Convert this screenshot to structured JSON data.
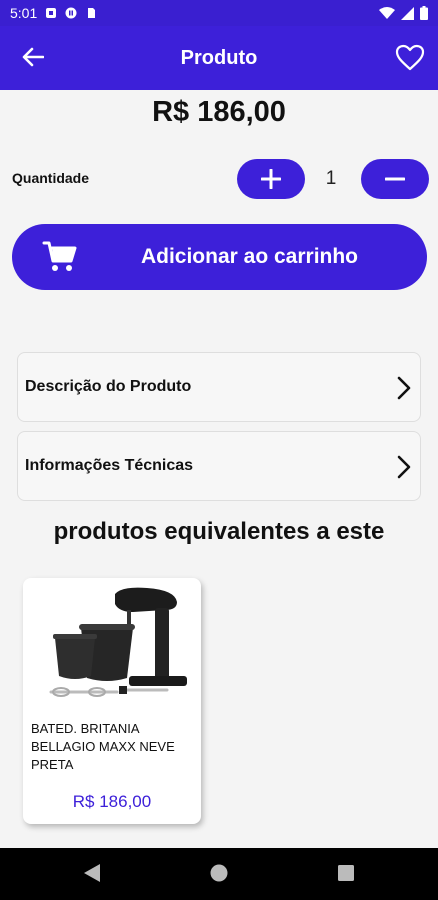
{
  "status_bar": {
    "time": "5:01",
    "left_icons": [
      "notification-square-icon",
      "pause-circle-icon",
      "sim-card-icon"
    ],
    "right_icons": [
      "wifi-icon",
      "signal-icon",
      "battery-icon"
    ]
  },
  "app_bar": {
    "title": "Produto",
    "back_icon": "arrow-left-icon",
    "favorite_icon": "heart-outline-icon"
  },
  "product": {
    "price": "R$ 186,00"
  },
  "quantity": {
    "label": "Quantidade",
    "value": "1",
    "increment_icon": "plus-icon",
    "decrement_icon": "minus-icon"
  },
  "add_to_cart": {
    "label": "Adicionar ao carrinho",
    "icon": "cart-icon"
  },
  "sections": [
    {
      "label": "Descrição do Produto",
      "icon": "chevron-right-icon"
    },
    {
      "label": "Informações Técnicas",
      "icon": "chevron-right-icon"
    }
  ],
  "related": {
    "title": "produtos equivalentes a este",
    "items": [
      {
        "name": "BATED. BRITANIA BELLAGIO MAXX NEVE PRETA",
        "price": "R$ 186,00"
      }
    ]
  },
  "colors": {
    "primary": "#3d20d9",
    "background": "#f4f4f4",
    "card": "#ffffff"
  }
}
